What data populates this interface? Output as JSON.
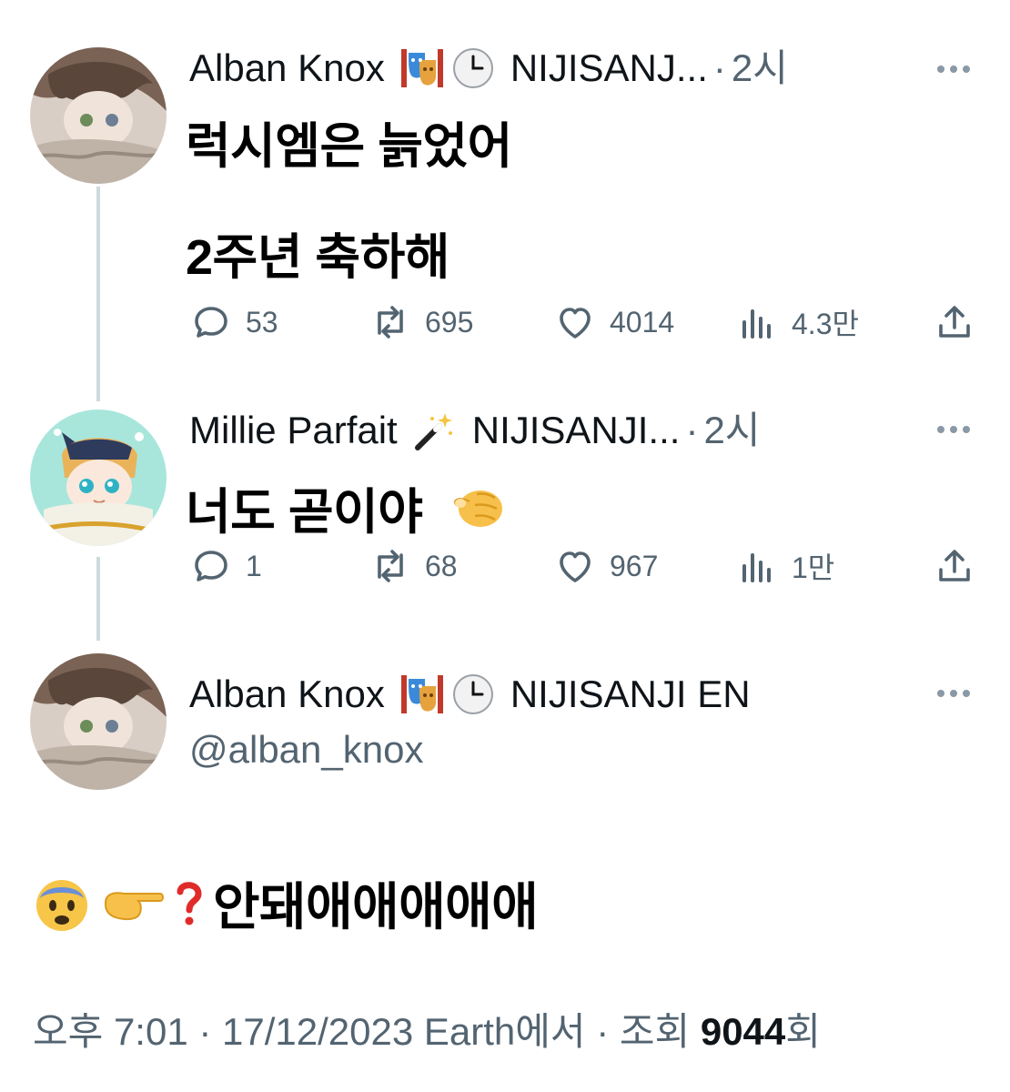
{
  "tweets": [
    {
      "author": "Alban Knox",
      "org": "NIJISANJ...",
      "separator": "·",
      "time": "2시",
      "text_lines": [
        "럭시엠은 늙었어",
        "2주년 축하해"
      ],
      "stats": {
        "replies": "53",
        "retweets": "695",
        "likes": "4014",
        "views": "4.3만"
      }
    },
    {
      "author": "Millie Parfait",
      "org": "NIJISANJI...",
      "separator": "·",
      "time": "2시",
      "text_lines": [
        "너도 곧이야"
      ],
      "stats": {
        "replies": "1",
        "retweets": "68",
        "likes": "967",
        "views": "1만"
      }
    }
  ],
  "main": {
    "author": "Alban Knox",
    "org": "NIJISANJI EN",
    "handle": "@alban_knox",
    "text": "안돼애애애애애",
    "meta_prefix": "오후 7:01 · 17/12/2023 Earth에서 · 조회 ",
    "views": "9044",
    "meta_suffix": "회"
  },
  "icons": {
    "masks": "performing-arts-icon",
    "clock": "clock-icon",
    "wand": "magic-wand-icon",
    "pointing": "pointing-at-viewer-icon",
    "fearful": "fearful-face-icon",
    "point_right": "backhand-index-right-icon",
    "question": "red-question-mark-icon"
  },
  "colors": {
    "text": "#0f1419",
    "muted": "#536471",
    "thread_line": "#cfd9de"
  }
}
